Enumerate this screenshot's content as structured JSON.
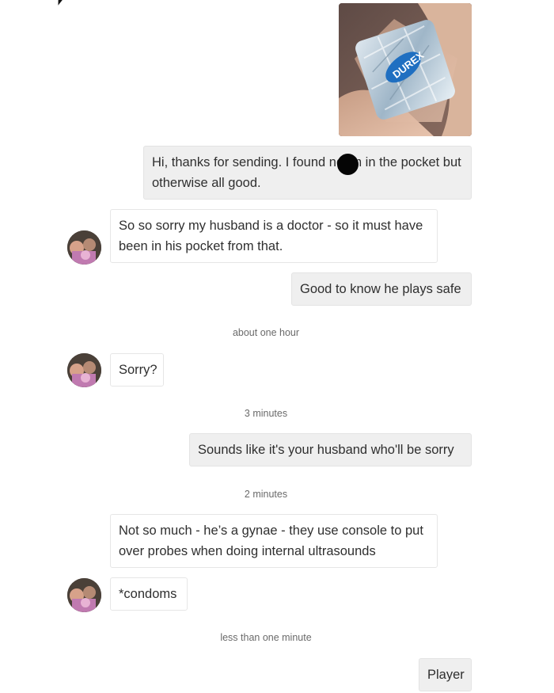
{
  "photo": {
    "alt_icon": "condom-wrapper-photo",
    "wrapper_text": "DUREX"
  },
  "messages": [
    {
      "text": "Hi, thanks for sending. I found  ndom in the pocket but otherwise all good."
    },
    {
      "text": "So so sorry my husband is a doctor - so it must have been in his pocket from that."
    },
    {
      "text": "Good to know he plays safe"
    },
    {
      "text": "Sorry?"
    },
    {
      "text": "Sounds like it's your husband who'll be sorry"
    },
    {
      "text": "Not so much - he’s a gynae - they use console to put over probes when doing internal ultrasounds"
    },
    {
      "text": "*condoms"
    },
    {
      "text": "Player"
    }
  ],
  "timestamps": [
    "about one hour",
    "3 minutes",
    "2 minutes",
    "less than one minute"
  ],
  "colors": {
    "outgoing_bubble": "#efefef",
    "incoming_bubble": "#ffffff",
    "timestamp_text": "#6a6a6a"
  }
}
